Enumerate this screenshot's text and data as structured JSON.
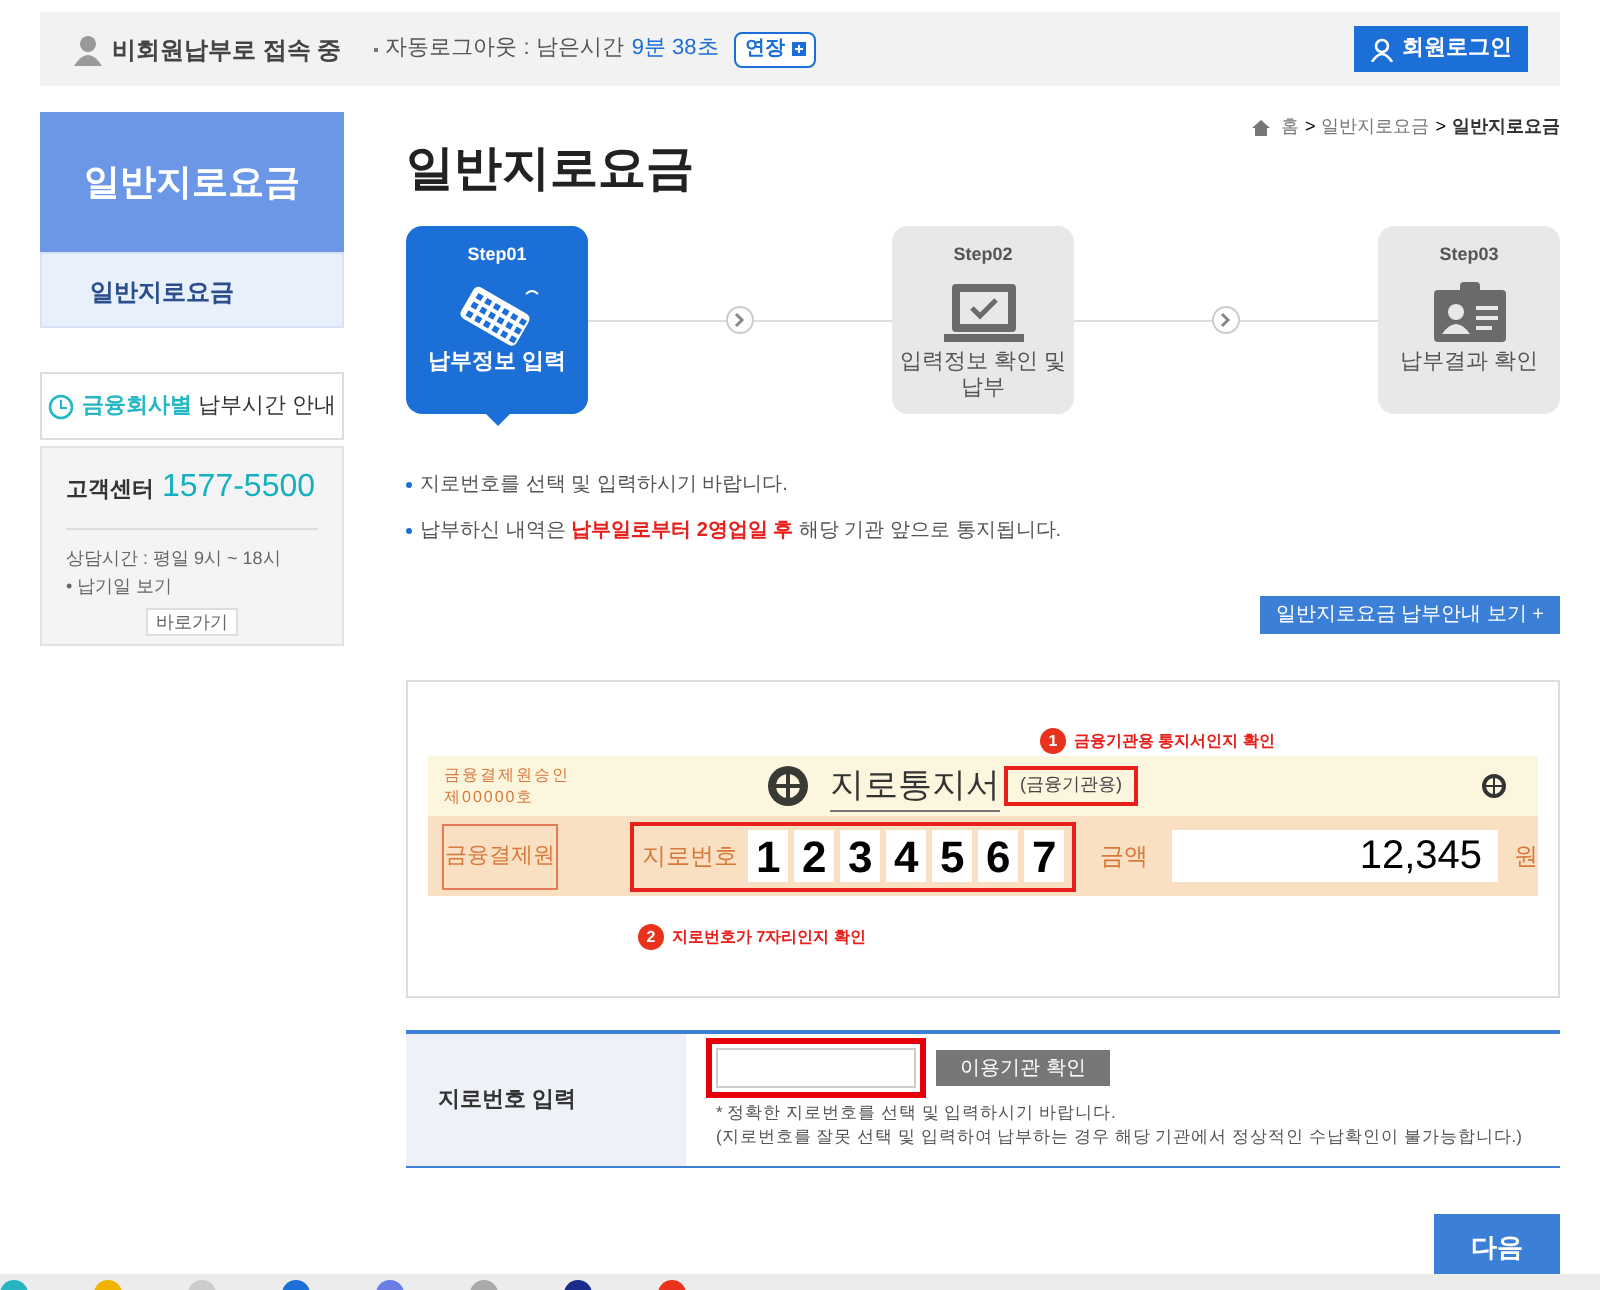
{
  "top_bar": {
    "status": "비회원납부로 접속 중",
    "auto_logout_label": "자동로그아웃 : 남은시간",
    "remaining_time": "9분 38초",
    "extend_button": "연장",
    "login_button": "회원로그인"
  },
  "breadcrumb": {
    "separator": ">",
    "items": [
      {
        "label": "홈",
        "selected": false
      },
      {
        "label": "일반지로요금",
        "selected": false
      },
      {
        "label": "일반지로요금",
        "selected": true
      }
    ]
  },
  "sidebar": {
    "title": "일반지로요금",
    "items": [
      {
        "label": "일반지로요금",
        "selected": true
      }
    ],
    "hours_link": {
      "highlight": "금융회사별",
      "text": "납부시간 안내"
    },
    "support": {
      "label": "고객센터",
      "phone": "1577-5500",
      "hours": "상담시간 : 평일 9시 ~ 18시",
      "due_date": "• 납기일 보기",
      "button": "바로가기"
    }
  },
  "page_title": "일반지로요금",
  "steps": [
    {
      "kind": "keyboard",
      "step": "Step01",
      "title": "납부정보 입력",
      "selected": true
    },
    {
      "kind": "laptop",
      "step": "Step02",
      "title": "입력정보 확인 및 납부",
      "selected": false
    },
    {
      "kind": "idcard",
      "step": "Step03",
      "title": "납부결과 확인",
      "selected": false
    }
  ],
  "notes": [
    "지로번호를 선택 및 입력하시기 바랍니다.",
    "납부하신 내역은 **납부일로부터 2영업일 후** 해당 기관 앞으로 통지됩니다."
  ],
  "guide_button": "일반지로요금 납부안내 보기 +",
  "giro_sample": {
    "approval_line_1": "금융결제원승인",
    "approval_line_2": "제00000호",
    "title": "지로통지서",
    "subtitle": "(금융기관용)",
    "stamp": "금융결제원",
    "number_label": "지로번호",
    "digits": [
      "1",
      "2",
      "3",
      "4",
      "5",
      "6",
      "7"
    ],
    "amount_label": "금액",
    "amount": "12,345",
    "currency": "원",
    "annotations": [
      {
        "number": "1",
        "text": "금융기관용 통지서인지 확인"
      },
      {
        "number": "2",
        "text": "지로번호가 7자리인지 확인"
      }
    ]
  },
  "input_form": {
    "label": "지로번호 입력",
    "button": "이용기관 확인",
    "hints": [
      "* 정확한 지로번호를 선택 및 입력하시기 바랍니다.",
      "(지로번호를 잘못 선택 및 입력하여 납부하는 경우 해당 기관에서 정상적인 수납확인이 불가능합니다.)"
    ]
  },
  "next_button": "다음"
}
